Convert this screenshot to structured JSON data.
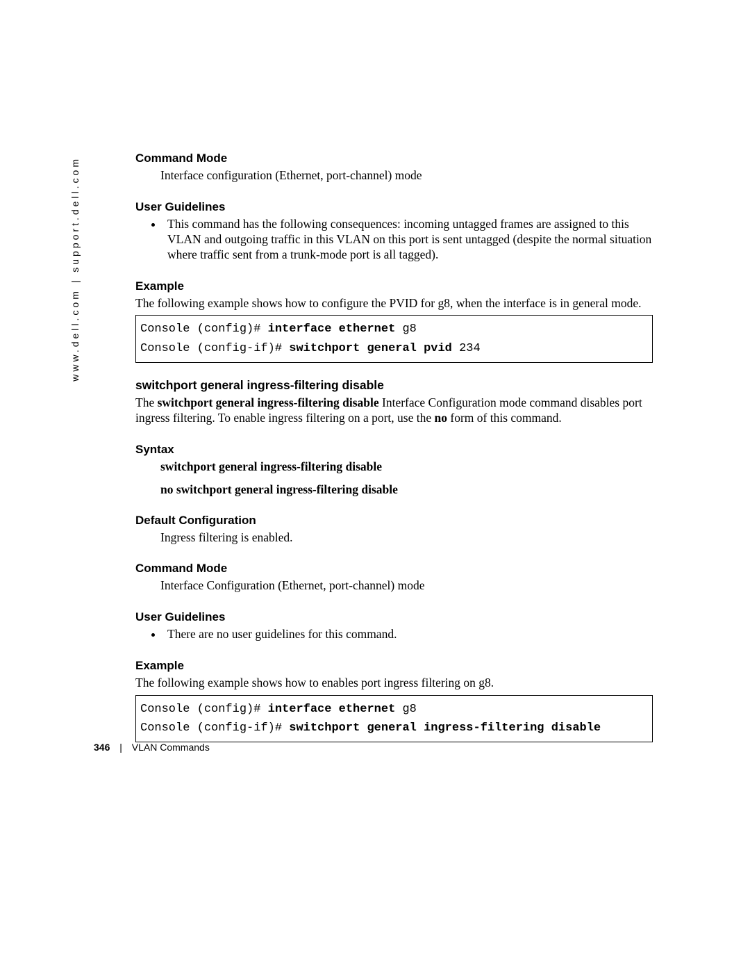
{
  "sidebar": "www.dell.com | support.dell.com",
  "s1": {
    "h_cmdmode": "Command Mode",
    "cmdmode_text": "Interface configuration (Ethernet, port-channel) mode",
    "h_userg": "User Guidelines",
    "userg_bullet": "This command has the following consequences: incoming untagged frames are assigned to this VLAN and outgoing traffic in this VLAN on this port is sent untagged (despite the normal situation where traffic sent from a trunk-mode port is all tagged).",
    "h_example": "Example",
    "example_intro": "The following example shows how to configure the PVID for g8, when the interface is in general mode.",
    "code_l1_a": "Console (config)# ",
    "code_l1_b": "interface ethernet",
    "code_l1_c": " g8",
    "code_l2_a": "Console (config-if)# ",
    "code_l2_b": "switchport general pvid",
    "code_l2_c": " 234"
  },
  "s2": {
    "title": "switchport general ingress-filtering disable",
    "intro_a": "The ",
    "intro_b": "switchport general ingress-filtering disable",
    "intro_c": " Interface Configuration mode command disables port ingress filtering. To enable ingress filtering on a port, use the ",
    "intro_d": "no",
    "intro_e": " form of this command.",
    "h_syntax": "Syntax",
    "syntax1": "switchport general ingress-filtering disable",
    "syntax2": "no switchport general ingress-filtering disable",
    "h_default": "Default Configuration",
    "default_text": "Ingress filtering is enabled.",
    "h_cmdmode": "Command Mode",
    "cmdmode_text": "Interface Configuration (Ethernet, port-channel) mode",
    "h_userg": "User Guidelines",
    "userg_bullet": "There are no user guidelines for this command.",
    "h_example": "Example",
    "example_intro": "The following example shows how to enables port ingress filtering on g8.",
    "code_l1_a": "Console (config)# ",
    "code_l1_b": "interface ethernet",
    "code_l1_c": " g8",
    "code_l2_a": "Console (config-if)# ",
    "code_l2_b": "switchport general ingress-filtering disable"
  },
  "footer": {
    "page": "346",
    "section": "VLAN Commands"
  }
}
